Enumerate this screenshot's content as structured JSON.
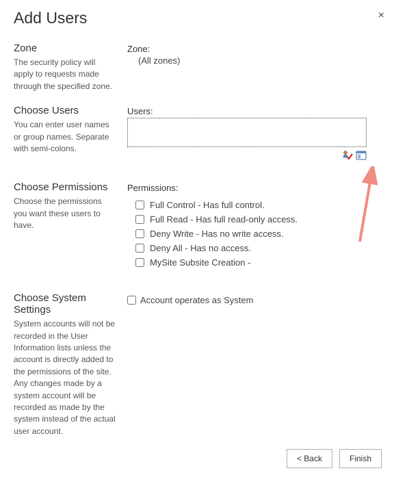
{
  "dialog": {
    "title": "Add Users",
    "close_label": "×"
  },
  "zone_section": {
    "heading": "Zone",
    "desc": "The security policy will apply to requests made through the specified zone.",
    "field_label": "Zone:",
    "value": "(All zones)"
  },
  "users_section": {
    "heading": "Choose Users",
    "desc": "You can enter user names or group names. Separate with semi-colons.",
    "field_label": "Users:",
    "input_value": ""
  },
  "permissions_section": {
    "heading": "Choose Permissions",
    "desc": "Choose the permissions you want these users to have.",
    "field_label": "Permissions:",
    "items": [
      "Full Control - Has full control.",
      "Full Read - Has full read-only access.",
      "Deny Write - Has no write access.",
      "Deny All - Has no access.",
      "MySite Subsite Creation -"
    ]
  },
  "system_section": {
    "heading": "Choose System Settings",
    "desc": "System accounts will not be recorded in the User Information lists unless the account is directly added to the permissions of the site. Any changes made by a system account will be recorded as made by the system instead of the actual user account.",
    "checkbox_label": "Account operates as System"
  },
  "footer": {
    "back": "< Back",
    "finish": "Finish"
  },
  "annotation": {
    "arrow_color": "#f28b82"
  }
}
